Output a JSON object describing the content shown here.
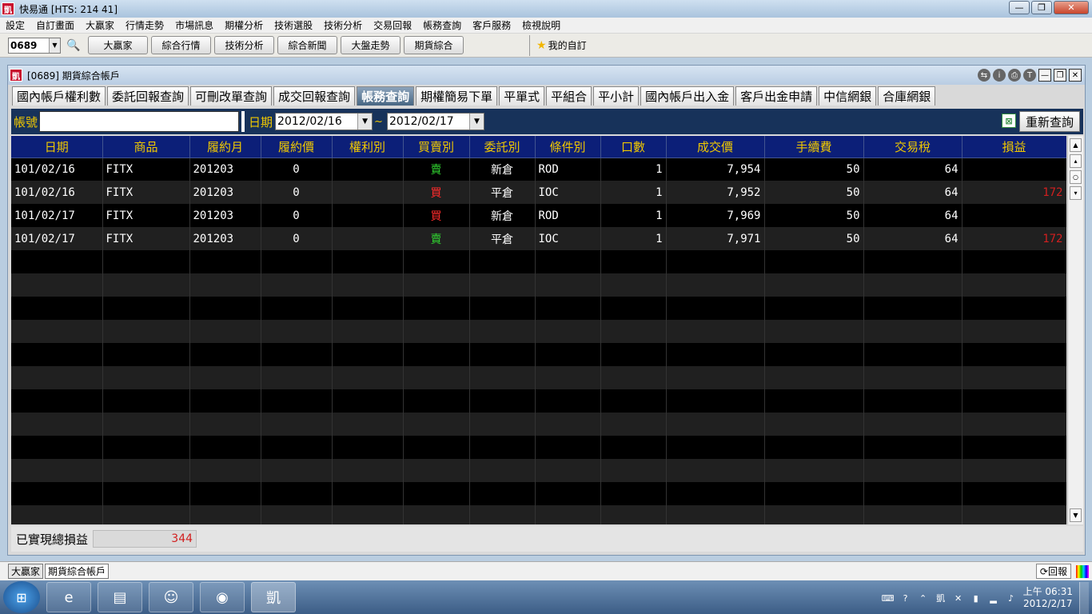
{
  "window": {
    "title": "快易通  [HTS: 214 41]",
    "icon": "app-logo-icon",
    "min": "—",
    "max": "❐",
    "close": "✕"
  },
  "menu": [
    "設定",
    "自訂畫面",
    "大贏家",
    "行情走勢",
    "市場訊息",
    "期權分析",
    "技術選股",
    "技術分析",
    "交易回報",
    "帳務查詢",
    "客戶服務",
    "檢視說明"
  ],
  "toolbar": {
    "code": "0689",
    "buttons": [
      "大贏家",
      "綜合行情",
      "技術分析",
      "綜合新聞",
      "大盤走勢",
      "期貨綜合"
    ],
    "favorite": "我的自訂"
  },
  "child_window": {
    "title": "[0689] 期貨綜合帳戶",
    "icon": "app-logo-icon"
  },
  "tabs": [
    "國內帳戶權利數",
    "委託回報查詢",
    "可刪改單查詢",
    "成交回報查詢",
    "帳務查詢",
    "期權簡易下單",
    "平單式",
    "平組合",
    "平小計",
    "國內帳戶出入金",
    "客戶出金申請",
    "中信網銀",
    "合庫網銀"
  ],
  "active_tab": "帳務查詢",
  "query": {
    "account_label": "帳號",
    "account_value": "",
    "date_label": "日期",
    "date_from": "2012/02/16",
    "date_to": "2012/02/17",
    "tilde": "~",
    "requery_label": "重新查詢"
  },
  "table": {
    "columns": [
      "日期",
      "商品",
      "履約月",
      "履約價",
      "權利別",
      "買賣別",
      "委託別",
      "條件別",
      "口數",
      "成交價",
      "手續費",
      "交易稅",
      "損益"
    ],
    "rows": [
      [
        "101/02/16",
        "FITX",
        "201203",
        "0",
        "",
        "賣",
        "新倉",
        "ROD",
        "1",
        "7,954",
        "50",
        "64",
        ""
      ],
      [
        "101/02/16",
        "FITX",
        "201203",
        "0",
        "",
        "買",
        "平倉",
        "IOC",
        "1",
        "7,952",
        "50",
        "64",
        "172"
      ],
      [
        "101/02/17",
        "FITX",
        "201203",
        "0",
        "",
        "買",
        "新倉",
        "ROD",
        "1",
        "7,969",
        "50",
        "64",
        ""
      ],
      [
        "101/02/17",
        "FITX",
        "201203",
        "0",
        "",
        "賣",
        "平倉",
        "IOC",
        "1",
        "7,971",
        "50",
        "64",
        "172"
      ]
    ]
  },
  "footer": {
    "label": "已實現總損益",
    "value": "344"
  },
  "statusbar": {
    "items": [
      "大贏家",
      "期貨綜合帳戶"
    ],
    "reply": "回報"
  },
  "clock": {
    "time": "上午 06:31",
    "date": "2012/2/17"
  },
  "colors": {
    "sell": "#2fd12f",
    "buy": "#ff2b2b",
    "profit": "#d21f1f",
    "header_bg": "#0c1f78",
    "header_text": "#f0c800",
    "query_bar": "#17325a"
  }
}
